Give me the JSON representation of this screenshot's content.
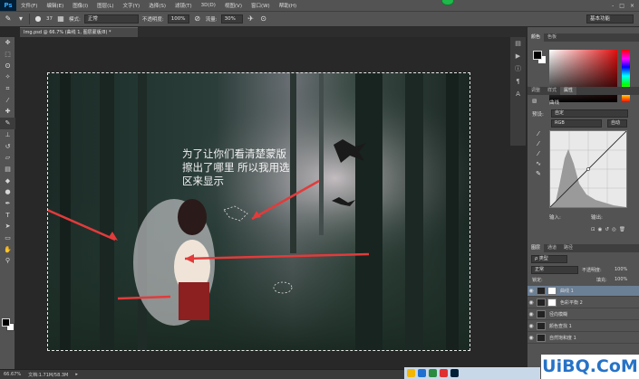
{
  "app": {
    "logo": "Ps"
  },
  "menu": [
    "文件(F)",
    "编辑(E)",
    "图像(I)",
    "图层(L)",
    "文字(Y)",
    "选择(S)",
    "滤镜(T)",
    "3D(D)",
    "视图(V)",
    "窗口(W)",
    "帮助(H)"
  ],
  "window_controls": [
    "-",
    "□",
    "×"
  ],
  "options_bar": {
    "tool_icon": "brush-icon",
    "brush_size": "37",
    "mode_label": "模式:",
    "mode_value": "正常",
    "opacity_label": "不透明度:",
    "opacity_value": "100%",
    "flow_label": "流量:",
    "flow_value": "30%",
    "workspace": "基本功能"
  },
  "document_tab": "Img.psd @ 66.7% (曲线 1, 图层蒙版/8) *",
  "annotation": {
    "line1": "为了让你们看清楚蒙版",
    "line2": "擦出了哪里 所以我用选",
    "line3": "区来显示"
  },
  "status_bar": {
    "zoom": "66.67%",
    "doc": "文档:1.71M/58.3M"
  },
  "color_panel": {
    "tabs": [
      "颜色",
      "色板"
    ]
  },
  "properties_panel": {
    "tabs": [
      "调整",
      "样式",
      "属性"
    ],
    "title": "曲线",
    "preset_label": "预设:",
    "preset_value": "自定",
    "channel_value": "RGB",
    "auto_label": "自动",
    "input_label": "输入:",
    "output_label": "输出:"
  },
  "layers_panel": {
    "tabs": [
      "图层",
      "通道",
      "路径"
    ],
    "filter_value": "ρ 类型",
    "blend_value": "正常",
    "opacity_label": "不透明度:",
    "opacity_value": "100%",
    "lock_label": "锁定:",
    "fill_label": "填充:",
    "fill_value": "100%",
    "layers": [
      {
        "name": "曲线 1"
      },
      {
        "name": "色彩平衡 2"
      },
      {
        "name": "径向模糊"
      },
      {
        "name": "颜色查找 1"
      },
      {
        "name": "自然饱和度 1"
      }
    ]
  },
  "watermark": "UiBQ.CoM"
}
